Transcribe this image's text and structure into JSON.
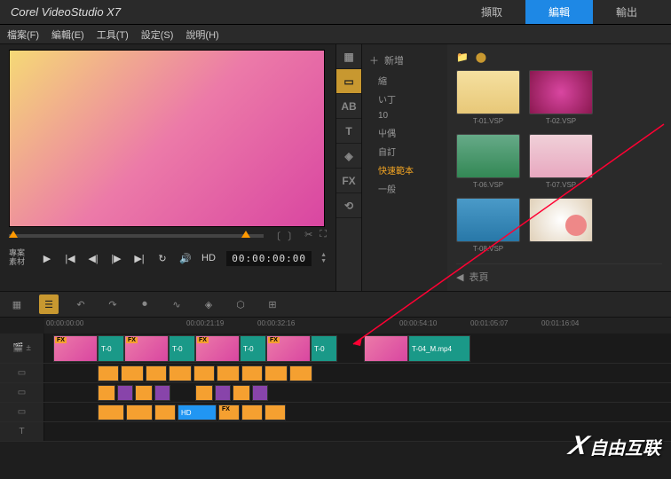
{
  "title": "Corel VideoStudio X7",
  "mainTabs": {
    "capture": "擷取",
    "edit": "編輯",
    "output": "輸出"
  },
  "menu": {
    "file": "檔案(F)",
    "edit": "編輯(E)",
    "tools": "工具(T)",
    "settings": "設定(S)",
    "help": "說明(H)"
  },
  "preview": {
    "label": "專案\n素材",
    "hd": "HD",
    "timecode": "00:00:00:00"
  },
  "sideTabs": {
    "media": "▦",
    "template": "▭",
    "ab": "AB",
    "text": "T",
    "path": "◈",
    "fx": "FX",
    "link": "⟲"
  },
  "lib": {
    "add": "新增",
    "items": {
      "a": "縮",
      "b": "い丁",
      "c": "10",
      "d": "屮偶",
      "e": "自訂",
      "f": "快速範本",
      "g": "一般"
    },
    "bottomLabel": "表頁"
  },
  "thumbs": {
    "t1": "T-01.VSP",
    "t2": "T-02.VSP",
    "t3": "T-06.VSP",
    "t4": "T-07.VSP",
    "t5": "T-08.VSP",
    "t6": ""
  },
  "ruler": {
    "r0": "00:00:00:00",
    "r1": "00:00:21:19",
    "r2": "00:00:32:16",
    "r3": "00:00:54:10",
    "r4": "00:01:05:07",
    "r5": "00:01:16:04"
  },
  "clips": {
    "c1": "T-0",
    "c2": "T-0",
    "c3": "T-0",
    "c4": "T-0",
    "c5": "T-04_M.mp4",
    "hd": "HD"
  },
  "watermark": "自由互联"
}
